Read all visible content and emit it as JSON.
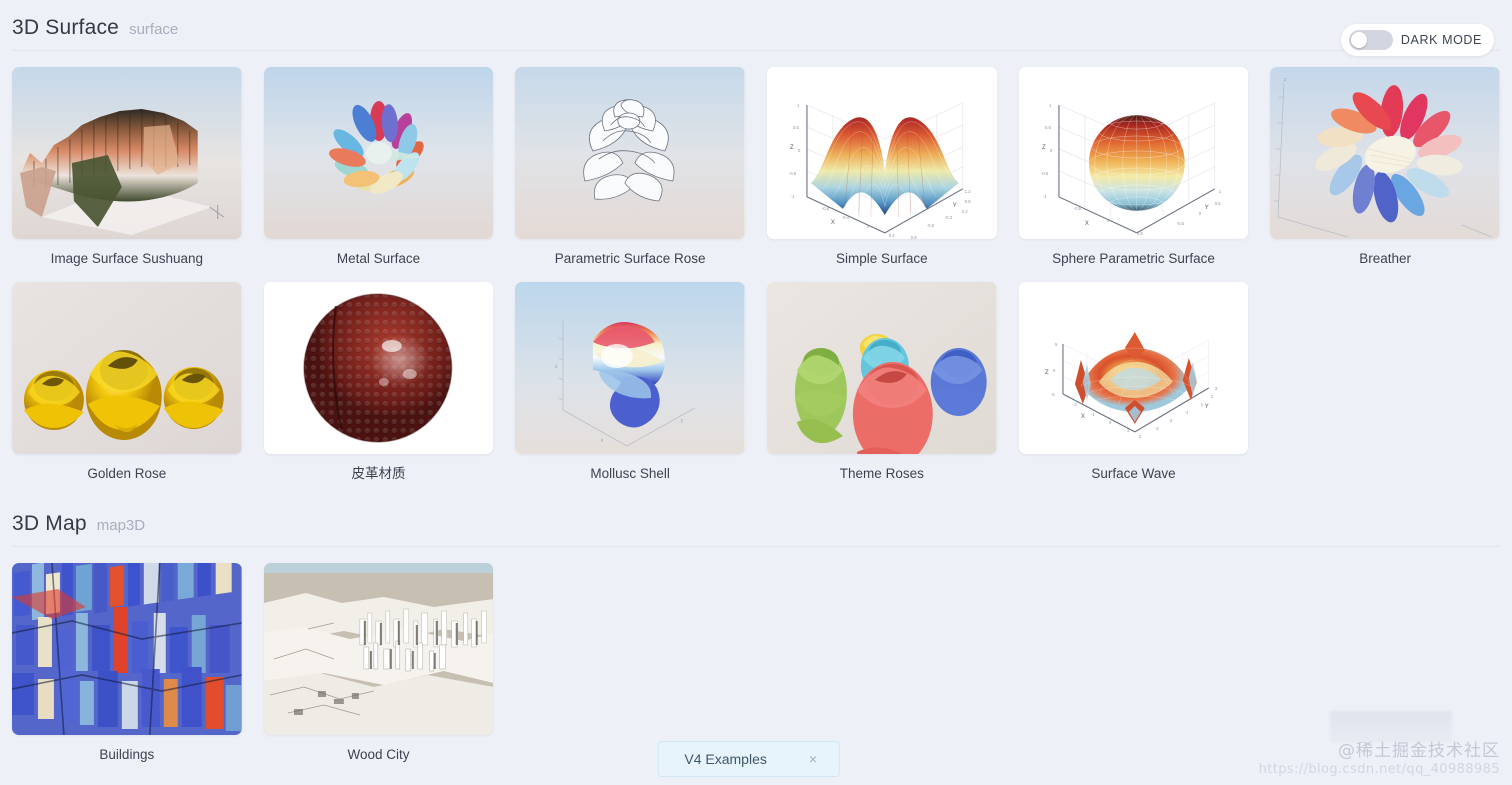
{
  "header": {
    "dark_mode_label": "DARK MODE",
    "dark_mode_on": false
  },
  "sections": [
    {
      "title": "3D Surface",
      "subtitle": "surface",
      "cards": [
        {
          "label": "Image Surface Sushuang",
          "thumb": "image-surface-sushuang"
        },
        {
          "label": "Metal Surface",
          "thumb": "metal-surface"
        },
        {
          "label": "Parametric Surface Rose",
          "thumb": "parametric-surface-rose"
        },
        {
          "label": "Simple Surface",
          "thumb": "simple-surface"
        },
        {
          "label": "Sphere Parametric Surface",
          "thumb": "sphere-parametric-surface"
        },
        {
          "label": "Breather",
          "thumb": "breather"
        },
        {
          "label": "Golden Rose",
          "thumb": "golden-rose"
        },
        {
          "label": "皮革材质",
          "thumb": "leather-material"
        },
        {
          "label": "Mollusc Shell",
          "thumb": "mollusc-shell"
        },
        {
          "label": "Theme Roses",
          "thumb": "theme-roses"
        },
        {
          "label": "Surface Wave",
          "thumb": "surface-wave"
        }
      ]
    },
    {
      "title": "3D Map",
      "subtitle": "map3D",
      "cards": [
        {
          "label": "Buildings",
          "thumb": "buildings"
        },
        {
          "label": "Wood City",
          "thumb": "wood-city"
        }
      ]
    }
  ],
  "notification": {
    "text": "V4 Examples",
    "close_glyph": "×"
  },
  "watermark": {
    "handle": "@稀土掘金技术社区",
    "url": "https://blog.csdn.net/qq_40988985"
  },
  "colors": {
    "page_background": "#eef0f7",
    "section_title": "#333a44",
    "section_subtitle": "#a9adbd",
    "notify_background": "#e8f4fb",
    "notify_text": "#40566b"
  },
  "axis_labels": {
    "x": "X",
    "y": "Y",
    "z": "Z"
  }
}
